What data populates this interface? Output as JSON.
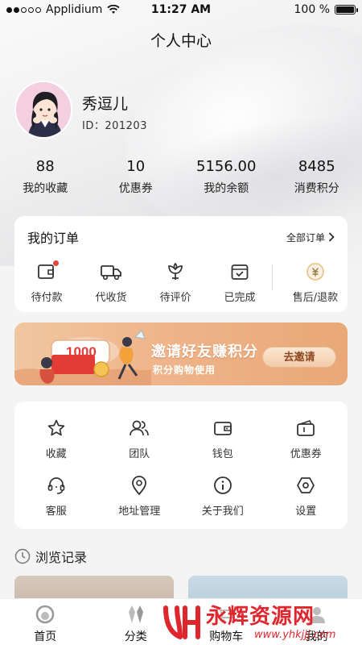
{
  "status_bar": {
    "carrier": "Applidium",
    "time": "11:27 AM",
    "battery_text": "100 %",
    "battery_level": 1.0
  },
  "header": {
    "title": "个人中心"
  },
  "profile": {
    "name": "秀逗儿",
    "id_text": "ID：201203"
  },
  "stats": [
    {
      "value": "88",
      "label": "我的收藏"
    },
    {
      "value": "10",
      "label": "优惠券"
    },
    {
      "value": "5156.00",
      "label": "我的余额"
    },
    {
      "value": "8485",
      "label": "消费积分"
    }
  ],
  "orders": {
    "title": "我的订单",
    "all_label": "全部订单",
    "items": [
      {
        "label": "待付款",
        "icon": "wallet-pending-icon",
        "has_dot": true
      },
      {
        "label": "代收货",
        "icon": "truck-icon",
        "has_dot": false
      },
      {
        "label": "待评价",
        "icon": "flower-icon",
        "has_dot": false
      },
      {
        "label": "已完成",
        "icon": "box-check-icon",
        "has_dot": false
      },
      {
        "label": "售后/退款",
        "icon": "refund-icon",
        "has_dot": false
      }
    ]
  },
  "banner": {
    "title": "邀请好友赚积分",
    "subtitle": "积分购物使用",
    "button_label": "去邀请",
    "badge_text": "1000"
  },
  "services": [
    {
      "label": "收藏",
      "icon": "star-icon"
    },
    {
      "label": "团队",
      "icon": "team-icon"
    },
    {
      "label": "钱包",
      "icon": "wallet-icon"
    },
    {
      "label": "优惠券",
      "icon": "coupon-icon"
    },
    {
      "label": "客服",
      "icon": "headset-icon"
    },
    {
      "label": "地址管理",
      "icon": "location-icon"
    },
    {
      "label": "关于我们",
      "icon": "info-icon"
    },
    {
      "label": "设置",
      "icon": "settings-icon"
    }
  ],
  "history": {
    "title": "浏览记录"
  },
  "tabbar": [
    {
      "label": "首页",
      "icon": "home-icon"
    },
    {
      "label": "分类",
      "icon": "category-icon"
    },
    {
      "label": "购物车",
      "icon": "cart-icon"
    },
    {
      "label": "我的",
      "icon": "user-icon"
    }
  ],
  "watermark": {
    "main": "永辉资源网",
    "sub": "www.yhkjjj.com"
  },
  "colors": {
    "accent": "#e0473b",
    "banner_orange": "#efb48a",
    "watermark_red": "#e0262d"
  }
}
